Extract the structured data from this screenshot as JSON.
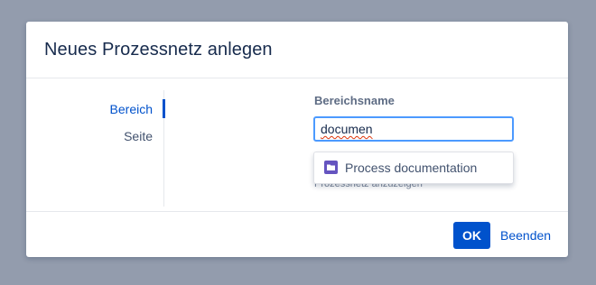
{
  "dialog": {
    "title": "Neues Prozessnetz anlegen",
    "nav": [
      {
        "label": "Bereich",
        "active": true
      },
      {
        "label": "Seite",
        "active": false
      }
    ],
    "field": {
      "label": "Bereichsname",
      "value": "documen",
      "helper_text": "Prozessnetz anzuzeigen"
    },
    "suggestion": {
      "icon": "folder-icon",
      "label": "Process documentation"
    },
    "footer": {
      "ok_label": "OK",
      "cancel_label": "Beenden"
    }
  },
  "colors": {
    "overlay": "#939cad",
    "accent": "#0052cc",
    "focus_border": "#4c9aff",
    "suggestion_icon": "#6554c0"
  }
}
